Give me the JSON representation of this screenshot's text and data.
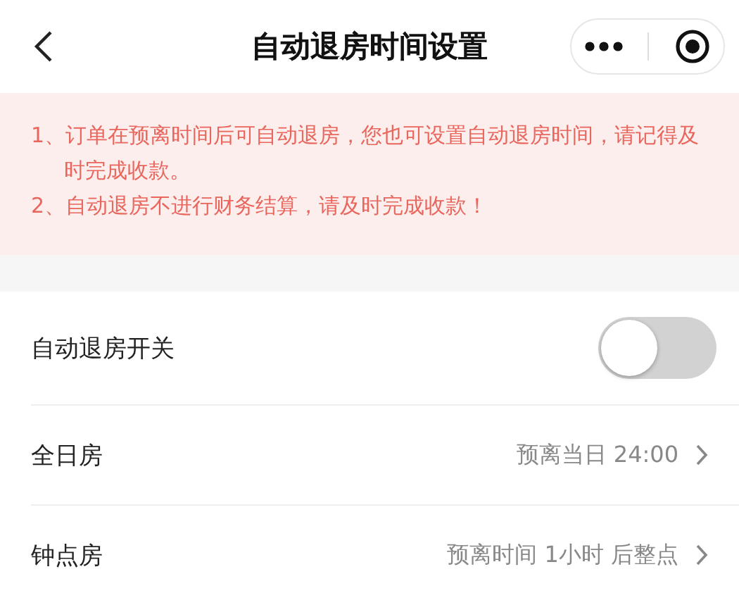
{
  "header": {
    "title": "自动退房时间设置"
  },
  "notice": {
    "lines": [
      "1、订单在预离时间后可自动退房，您也可设置自动退房时间，请记得及时完成收款。",
      "2、自动退房不进行财务结算，请及时完成收款！"
    ]
  },
  "settings": [
    {
      "kind": "switch",
      "label": "自动退房开关",
      "on": false
    },
    {
      "kind": "link",
      "label": "全日房",
      "value": "预离当日 24:00"
    },
    {
      "kind": "link",
      "label": "钟点房",
      "value": "预离时间 1小时 后整点"
    }
  ]
}
